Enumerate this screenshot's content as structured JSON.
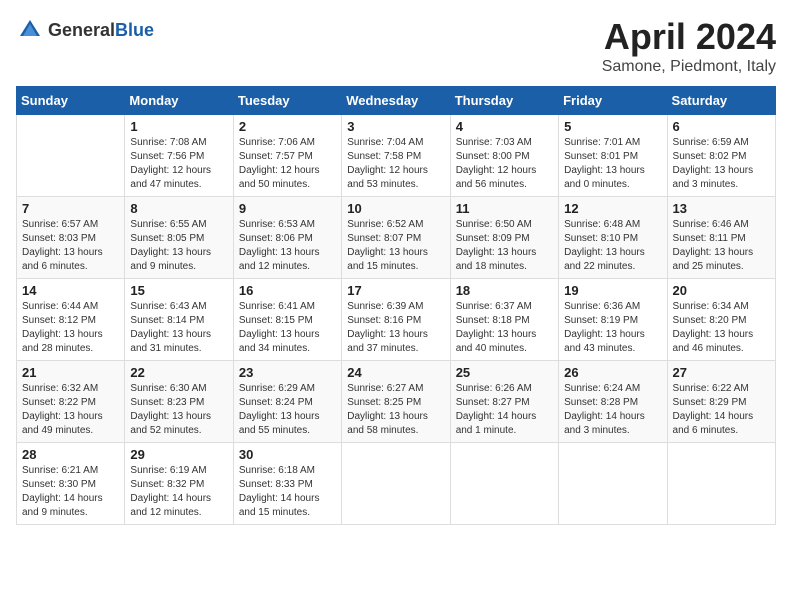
{
  "header": {
    "logo_general": "General",
    "logo_blue": "Blue",
    "title": "April 2024",
    "subtitle": "Samone, Piedmont, Italy"
  },
  "weekdays": [
    "Sunday",
    "Monday",
    "Tuesday",
    "Wednesday",
    "Thursday",
    "Friday",
    "Saturday"
  ],
  "weeks": [
    [
      {
        "day": "",
        "info": ""
      },
      {
        "day": "1",
        "info": "Sunrise: 7:08 AM\nSunset: 7:56 PM\nDaylight: 12 hours\nand 47 minutes."
      },
      {
        "day": "2",
        "info": "Sunrise: 7:06 AM\nSunset: 7:57 PM\nDaylight: 12 hours\nand 50 minutes."
      },
      {
        "day": "3",
        "info": "Sunrise: 7:04 AM\nSunset: 7:58 PM\nDaylight: 12 hours\nand 53 minutes."
      },
      {
        "day": "4",
        "info": "Sunrise: 7:03 AM\nSunset: 8:00 PM\nDaylight: 12 hours\nand 56 minutes."
      },
      {
        "day": "5",
        "info": "Sunrise: 7:01 AM\nSunset: 8:01 PM\nDaylight: 13 hours\nand 0 minutes."
      },
      {
        "day": "6",
        "info": "Sunrise: 6:59 AM\nSunset: 8:02 PM\nDaylight: 13 hours\nand 3 minutes."
      }
    ],
    [
      {
        "day": "7",
        "info": "Sunrise: 6:57 AM\nSunset: 8:03 PM\nDaylight: 13 hours\nand 6 minutes."
      },
      {
        "day": "8",
        "info": "Sunrise: 6:55 AM\nSunset: 8:05 PM\nDaylight: 13 hours\nand 9 minutes."
      },
      {
        "day": "9",
        "info": "Sunrise: 6:53 AM\nSunset: 8:06 PM\nDaylight: 13 hours\nand 12 minutes."
      },
      {
        "day": "10",
        "info": "Sunrise: 6:52 AM\nSunset: 8:07 PM\nDaylight: 13 hours\nand 15 minutes."
      },
      {
        "day": "11",
        "info": "Sunrise: 6:50 AM\nSunset: 8:09 PM\nDaylight: 13 hours\nand 18 minutes."
      },
      {
        "day": "12",
        "info": "Sunrise: 6:48 AM\nSunset: 8:10 PM\nDaylight: 13 hours\nand 22 minutes."
      },
      {
        "day": "13",
        "info": "Sunrise: 6:46 AM\nSunset: 8:11 PM\nDaylight: 13 hours\nand 25 minutes."
      }
    ],
    [
      {
        "day": "14",
        "info": "Sunrise: 6:44 AM\nSunset: 8:12 PM\nDaylight: 13 hours\nand 28 minutes."
      },
      {
        "day": "15",
        "info": "Sunrise: 6:43 AM\nSunset: 8:14 PM\nDaylight: 13 hours\nand 31 minutes."
      },
      {
        "day": "16",
        "info": "Sunrise: 6:41 AM\nSunset: 8:15 PM\nDaylight: 13 hours\nand 34 minutes."
      },
      {
        "day": "17",
        "info": "Sunrise: 6:39 AM\nSunset: 8:16 PM\nDaylight: 13 hours\nand 37 minutes."
      },
      {
        "day": "18",
        "info": "Sunrise: 6:37 AM\nSunset: 8:18 PM\nDaylight: 13 hours\nand 40 minutes."
      },
      {
        "day": "19",
        "info": "Sunrise: 6:36 AM\nSunset: 8:19 PM\nDaylight: 13 hours\nand 43 minutes."
      },
      {
        "day": "20",
        "info": "Sunrise: 6:34 AM\nSunset: 8:20 PM\nDaylight: 13 hours\nand 46 minutes."
      }
    ],
    [
      {
        "day": "21",
        "info": "Sunrise: 6:32 AM\nSunset: 8:22 PM\nDaylight: 13 hours\nand 49 minutes."
      },
      {
        "day": "22",
        "info": "Sunrise: 6:30 AM\nSunset: 8:23 PM\nDaylight: 13 hours\nand 52 minutes."
      },
      {
        "day": "23",
        "info": "Sunrise: 6:29 AM\nSunset: 8:24 PM\nDaylight: 13 hours\nand 55 minutes."
      },
      {
        "day": "24",
        "info": "Sunrise: 6:27 AM\nSunset: 8:25 PM\nDaylight: 13 hours\nand 58 minutes."
      },
      {
        "day": "25",
        "info": "Sunrise: 6:26 AM\nSunset: 8:27 PM\nDaylight: 14 hours\nand 1 minute."
      },
      {
        "day": "26",
        "info": "Sunrise: 6:24 AM\nSunset: 8:28 PM\nDaylight: 14 hours\nand 3 minutes."
      },
      {
        "day": "27",
        "info": "Sunrise: 6:22 AM\nSunset: 8:29 PM\nDaylight: 14 hours\nand 6 minutes."
      }
    ],
    [
      {
        "day": "28",
        "info": "Sunrise: 6:21 AM\nSunset: 8:30 PM\nDaylight: 14 hours\nand 9 minutes."
      },
      {
        "day": "29",
        "info": "Sunrise: 6:19 AM\nSunset: 8:32 PM\nDaylight: 14 hours\nand 12 minutes."
      },
      {
        "day": "30",
        "info": "Sunrise: 6:18 AM\nSunset: 8:33 PM\nDaylight: 14 hours\nand 15 minutes."
      },
      {
        "day": "",
        "info": ""
      },
      {
        "day": "",
        "info": ""
      },
      {
        "day": "",
        "info": ""
      },
      {
        "day": "",
        "info": ""
      }
    ]
  ]
}
